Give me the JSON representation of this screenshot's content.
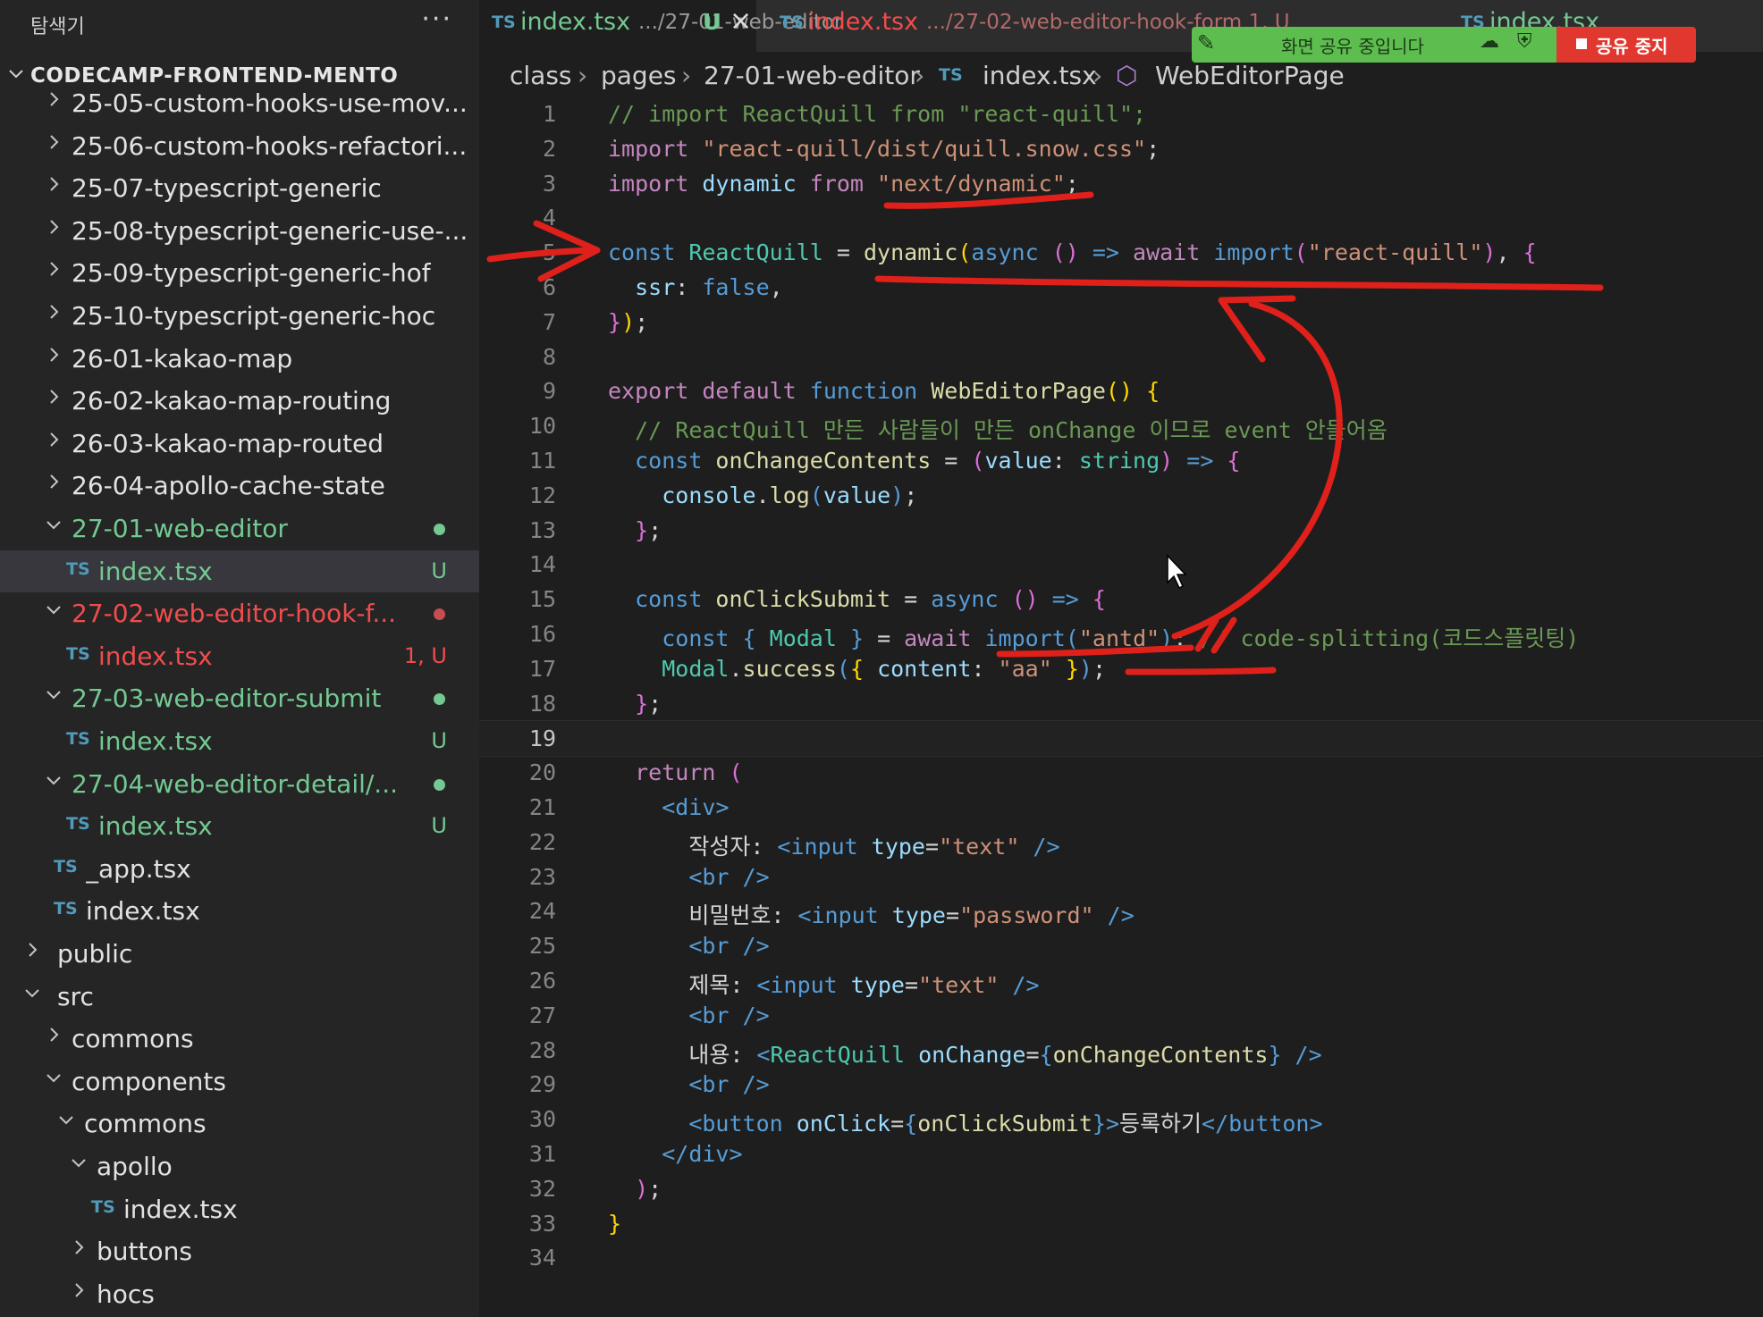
{
  "sidebar": {
    "title": "탐색기",
    "more": "···",
    "root": "CODECAMP-FRONTEND-MENTO",
    "items": [
      {
        "label": "25-05-custom-hooks-use-mov...",
        "kind": "folder",
        "open": false,
        "indent": 1
      },
      {
        "label": "25-06-custom-hooks-refactori...",
        "kind": "folder",
        "open": false,
        "indent": 1
      },
      {
        "label": "25-07-typescript-generic",
        "kind": "folder",
        "open": false,
        "indent": 1
      },
      {
        "label": "25-08-typescript-generic-use-...",
        "kind": "folder",
        "open": false,
        "indent": 1
      },
      {
        "label": "25-09-typescript-generic-hof",
        "kind": "folder",
        "open": false,
        "indent": 1
      },
      {
        "label": "25-10-typescript-generic-hoc",
        "kind": "folder",
        "open": false,
        "indent": 1
      },
      {
        "label": "26-01-kakao-map",
        "kind": "folder",
        "open": false,
        "indent": 1
      },
      {
        "label": "26-02-kakao-map-routing",
        "kind": "folder",
        "open": false,
        "indent": 1
      },
      {
        "label": "26-03-kakao-map-routed",
        "kind": "folder",
        "open": false,
        "indent": 1
      },
      {
        "label": "26-04-apollo-cache-state",
        "kind": "folder",
        "open": false,
        "indent": 1
      },
      {
        "label": "27-01-web-editor",
        "kind": "folder",
        "open": true,
        "indent": 1,
        "color": "#73c991",
        "dot": "#73c991"
      },
      {
        "label": "index.tsx",
        "kind": "file",
        "indent": 2,
        "color": "#73c991",
        "badge": "U",
        "badge_color": "#73c991",
        "selected": true
      },
      {
        "label": "27-02-web-editor-hook-f...",
        "kind": "folder",
        "open": true,
        "indent": 1,
        "color": "#f14c4c",
        "dot": "#c74e4e"
      },
      {
        "label": "index.tsx",
        "kind": "file",
        "indent": 2,
        "color": "#f14c4c",
        "badge": "1, U",
        "badge_color": "#f14c4c"
      },
      {
        "label": "27-03-web-editor-submit",
        "kind": "folder",
        "open": true,
        "indent": 1,
        "color": "#73c991",
        "dot": "#73c991"
      },
      {
        "label": "index.tsx",
        "kind": "file",
        "indent": 2,
        "color": "#73c991",
        "badge": "U",
        "badge_color": "#73c991"
      },
      {
        "label": "27-04-web-editor-detail/...",
        "kind": "folder",
        "open": true,
        "indent": 1,
        "color": "#73c991",
        "dot": "#73c991"
      },
      {
        "label": "index.tsx",
        "kind": "file",
        "indent": 2,
        "color": "#73c991",
        "badge": "U",
        "badge_color": "#73c991"
      },
      {
        "label": "_app.tsx",
        "kind": "file",
        "indent": 1
      },
      {
        "label": "index.tsx",
        "kind": "file",
        "indent": 1
      },
      {
        "label": "public",
        "kind": "folder",
        "open": false,
        "indent": 0
      },
      {
        "label": "src",
        "kind": "folder",
        "open": true,
        "indent": 0
      },
      {
        "label": "commons",
        "kind": "folder",
        "open": false,
        "indent": 1
      },
      {
        "label": "components",
        "kind": "folder",
        "open": true,
        "indent": 1
      },
      {
        "label": "commons",
        "kind": "folder",
        "open": true,
        "indent": 2
      },
      {
        "label": "apollo",
        "kind": "folder",
        "open": true,
        "indent": 3
      },
      {
        "label": "index.tsx",
        "kind": "file",
        "indent": 4
      },
      {
        "label": "buttons",
        "kind": "folder",
        "open": false,
        "indent": 3
      },
      {
        "label": "hocs",
        "kind": "folder",
        "open": false,
        "indent": 3
      }
    ]
  },
  "tabs": [
    {
      "name": "index.tsx",
      "path": ".../27-01-web-editor",
      "status": "U",
      "close": "×",
      "active": true,
      "color": "#73c991"
    },
    {
      "name": "index.tsx",
      "path": ".../27-02-web-editor-hook-form 1, U",
      "active": false,
      "color": "#f14c4c"
    },
    {
      "name": "index.tsx",
      "path": "",
      "active": false,
      "color": "#73c991"
    }
  ],
  "ts_badge": "TS",
  "breadcrumb": {
    "parts": [
      "class",
      "pages",
      "27-01-web-editor"
    ],
    "file": "index.tsx",
    "symbol_icon": "⬡",
    "symbol": "WebEditorPage",
    "sep": "›"
  },
  "screen_share": {
    "text": "화면 공유 중입니다",
    "stop": "공유 중지",
    "accent": "#5ebd4f",
    "stop_color": "#e0382f"
  },
  "editor": {
    "current_line": 19,
    "lines": [
      [
        [
          "c",
          "// import ReactQuill from \"react-quill\";"
        ]
      ],
      [
        [
          "k",
          "import "
        ],
        [
          "s",
          "\"react-quill/dist/quill.snow.css\""
        ],
        [
          "p",
          ";"
        ]
      ],
      [
        [
          "k",
          "import "
        ],
        [
          "v",
          "dynamic "
        ],
        [
          "k",
          "from "
        ],
        [
          "s",
          "\"next/dynamic\""
        ],
        [
          "p",
          ";"
        ]
      ],
      [],
      [
        [
          "sk",
          "const "
        ],
        [
          "t",
          "ReactQuill"
        ],
        [
          "p",
          " = "
        ],
        [
          "f",
          "dynamic"
        ],
        [
          "b",
          "("
        ],
        [
          "sk",
          "async "
        ],
        [
          "b2",
          "() "
        ],
        [
          "sk",
          "=> "
        ],
        [
          "k",
          "await "
        ],
        [
          "sk",
          "import"
        ],
        [
          "b2",
          "("
        ],
        [
          "s",
          "\"react-quill\""
        ],
        [
          "b2",
          ")"
        ],
        [
          "p",
          ", "
        ],
        [
          "b2",
          "{"
        ]
      ],
      [
        [
          "p",
          "  "
        ],
        [
          "v",
          "ssr"
        ],
        [
          "p",
          ": "
        ],
        [
          "sk",
          "false"
        ],
        [
          "p",
          ","
        ]
      ],
      [
        [
          "b2",
          "}"
        ],
        [
          "b",
          ")"
        ],
        [
          "p",
          ";"
        ]
      ],
      [],
      [
        [
          "k",
          "export default "
        ],
        [
          "sk",
          "function "
        ],
        [
          "f",
          "WebEditorPage"
        ],
        [
          "b",
          "() {"
        ]
      ],
      [
        [
          "p",
          "  "
        ],
        [
          "c",
          "// ReactQuill 만든 사람들이 만든 onChange 이므로 event 안들어옴"
        ]
      ],
      [
        [
          "p",
          "  "
        ],
        [
          "sk",
          "const "
        ],
        [
          "f",
          "onChangeContents"
        ],
        [
          "p",
          " = "
        ],
        [
          "b2",
          "("
        ],
        [
          "v",
          "value"
        ],
        [
          "p",
          ": "
        ],
        [
          "t",
          "string"
        ],
        [
          "b2",
          ") "
        ],
        [
          "sk",
          "=> "
        ],
        [
          "b2",
          "{"
        ]
      ],
      [
        [
          "p",
          "    "
        ],
        [
          "v",
          "console"
        ],
        [
          "p",
          "."
        ],
        [
          "f",
          "log"
        ],
        [
          "sk",
          "("
        ],
        [
          "v",
          "value"
        ],
        [
          "sk",
          ")"
        ],
        [
          "p",
          ";"
        ]
      ],
      [
        [
          "p",
          "  "
        ],
        [
          "b2",
          "}"
        ],
        [
          "p",
          ";"
        ]
      ],
      [],
      [
        [
          "p",
          "  "
        ],
        [
          "sk",
          "const "
        ],
        [
          "f",
          "onClickSubmit"
        ],
        [
          "p",
          " = "
        ],
        [
          "sk",
          "async "
        ],
        [
          "b2",
          "() "
        ],
        [
          "sk",
          "=> "
        ],
        [
          "b2",
          "{"
        ]
      ],
      [
        [
          "p",
          "    "
        ],
        [
          "sk",
          "const "
        ],
        [
          "sk",
          "{ "
        ],
        [
          "t",
          "Modal "
        ],
        [
          "sk",
          "} "
        ],
        [
          "p",
          "= "
        ],
        [
          "k",
          "await "
        ],
        [
          "sk",
          "import"
        ],
        [
          "sk",
          "("
        ],
        [
          "s",
          "\"antd\""
        ],
        [
          "sk",
          ")"
        ],
        [
          "p",
          "; "
        ],
        [
          "c",
          "// code-splitting(코드스플릿팅)"
        ]
      ],
      [
        [
          "p",
          "    "
        ],
        [
          "t",
          "Modal"
        ],
        [
          "p",
          "."
        ],
        [
          "f",
          "success"
        ],
        [
          "sk",
          "("
        ],
        [
          "b",
          "{ "
        ],
        [
          "v",
          "content"
        ],
        [
          "p",
          ": "
        ],
        [
          "s",
          "\"aa\" "
        ],
        [
          "b",
          "}"
        ],
        [
          "sk",
          ")"
        ],
        [
          "p",
          ";"
        ]
      ],
      [
        [
          "p",
          "  "
        ],
        [
          "b2",
          "}"
        ],
        [
          "p",
          ";"
        ]
      ],
      [],
      [
        [
          "p",
          "  "
        ],
        [
          "k",
          "return "
        ],
        [
          "b2",
          "("
        ]
      ],
      [
        [
          "p",
          "    "
        ],
        [
          "tg",
          "<"
        ],
        [
          "tg",
          "div"
        ],
        [
          "tg",
          ">"
        ]
      ],
      [
        [
          "p",
          "      "
        ],
        [
          "tx",
          "작성자: "
        ],
        [
          "tg",
          "<input "
        ],
        [
          "ta",
          "type"
        ],
        [
          "p",
          "="
        ],
        [
          "s",
          "\"text\" "
        ],
        [
          "tg",
          "/>"
        ]
      ],
      [
        [
          "p",
          "      "
        ],
        [
          "tg",
          "<br "
        ],
        [
          "tg",
          "/>"
        ]
      ],
      [
        [
          "p",
          "      "
        ],
        [
          "tx",
          "비밀번호: "
        ],
        [
          "tg",
          "<input "
        ],
        [
          "ta",
          "type"
        ],
        [
          "p",
          "="
        ],
        [
          "s",
          "\"password\" "
        ],
        [
          "tg",
          "/>"
        ]
      ],
      [
        [
          "p",
          "      "
        ],
        [
          "tg",
          "<br "
        ],
        [
          "tg",
          "/>"
        ]
      ],
      [
        [
          "p",
          "      "
        ],
        [
          "tx",
          "제목: "
        ],
        [
          "tg",
          "<input "
        ],
        [
          "ta",
          "type"
        ],
        [
          "p",
          "="
        ],
        [
          "s",
          "\"text\" "
        ],
        [
          "tg",
          "/>"
        ]
      ],
      [
        [
          "p",
          "      "
        ],
        [
          "tg",
          "<br "
        ],
        [
          "tg",
          "/>"
        ]
      ],
      [
        [
          "p",
          "      "
        ],
        [
          "tx",
          "내용: "
        ],
        [
          "tg",
          "<"
        ],
        [
          "t",
          "ReactQuill "
        ],
        [
          "ta",
          "onChange"
        ],
        [
          "p",
          "="
        ],
        [
          "sk",
          "{"
        ],
        [
          "f",
          "onChangeContents"
        ],
        [
          "sk",
          "} "
        ],
        [
          "tg",
          "/>"
        ]
      ],
      [
        [
          "p",
          "      "
        ],
        [
          "tg",
          "<br "
        ],
        [
          "tg",
          "/>"
        ]
      ],
      [
        [
          "p",
          "      "
        ],
        [
          "tg",
          "<button "
        ],
        [
          "ta",
          "onClick"
        ],
        [
          "p",
          "="
        ],
        [
          "sk",
          "{"
        ],
        [
          "f",
          "onClickSubmit"
        ],
        [
          "sk",
          "}"
        ],
        [
          "tg",
          ">"
        ],
        [
          "tx",
          "등록하기"
        ],
        [
          "tg",
          "</button>"
        ]
      ],
      [
        [
          "p",
          "    "
        ],
        [
          "tg",
          "</div>"
        ]
      ],
      [
        [
          "p",
          "  "
        ],
        [
          "b2",
          ")"
        ],
        [
          "p",
          ";"
        ]
      ],
      [
        [
          "b",
          "}"
        ]
      ],
      []
    ]
  },
  "cursor": {
    "icon": "mouse-pointer-icon"
  }
}
